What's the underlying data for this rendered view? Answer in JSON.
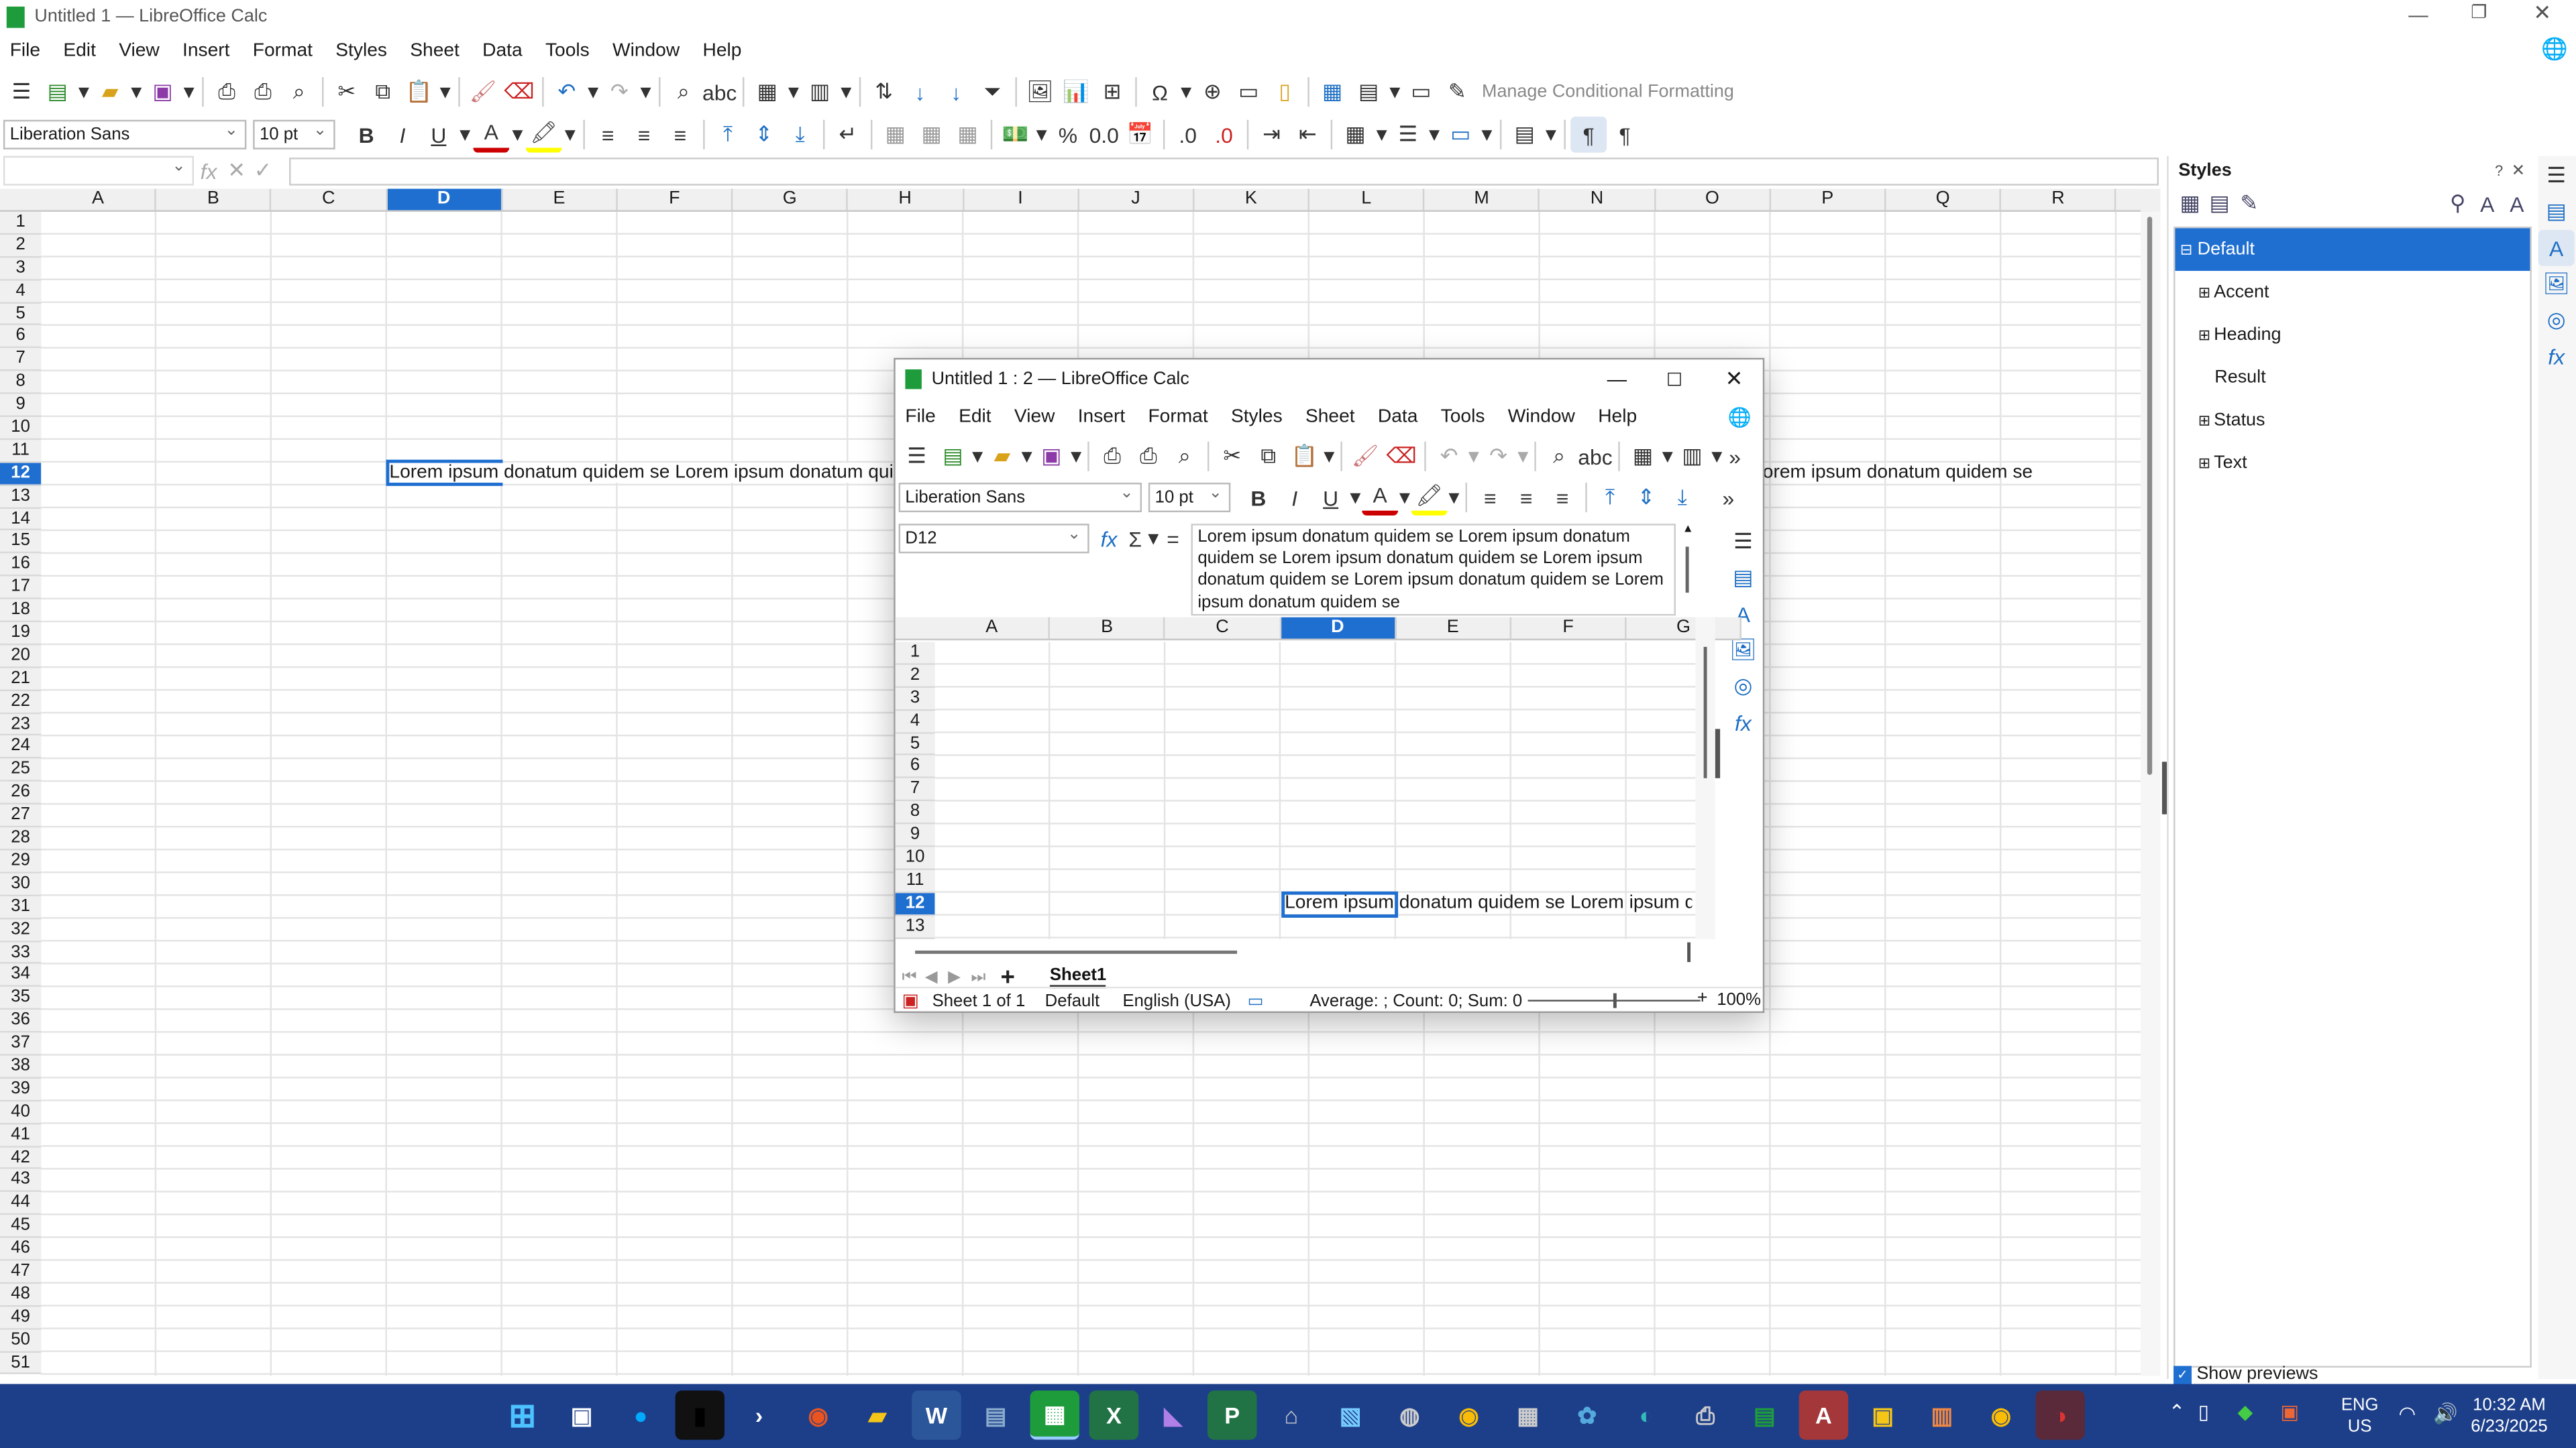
{
  "main": {
    "title": "Untitled 1 — LibreOffice Calc",
    "menu": [
      "File",
      "Edit",
      "View",
      "Insert",
      "Format",
      "Styles",
      "Sheet",
      "Data",
      "Tools",
      "Window",
      "Help"
    ],
    "font_name": "Liberation Sans",
    "font_size": "10 pt",
    "cf_label": "Manage Conditional Formatting",
    "columns": [
      "A",
      "B",
      "C",
      "D",
      "E",
      "F",
      "G",
      "H",
      "I",
      "J",
      "K",
      "L",
      "M",
      "N",
      "O",
      "P",
      "Q",
      "R"
    ],
    "selected_col": "D",
    "selected_row": "12",
    "rows": [
      "1",
      "2",
      "3",
      "4",
      "5",
      "6",
      "7",
      "8",
      "9",
      "10",
      "11",
      "12",
      "13",
      "14",
      "15",
      "16",
      "17",
      "18",
      "19",
      "20",
      "21",
      "22",
      "23",
      "24",
      "25",
      "26",
      "27",
      "28",
      "29",
      "30",
      "31",
      "32",
      "33",
      "34",
      "35",
      "36",
      "37",
      "38",
      "39",
      "40",
      "41",
      "42",
      "43",
      "44",
      "45",
      "46",
      "47",
      "48",
      "49",
      "50",
      "51"
    ],
    "cell_text_left": "Lorem ipsum donatum quidem se Lorem ipsum donatum quidem",
    "cell_text_right": "orem ipsum donatum quidem se"
  },
  "sidebar": {
    "title": "Styles",
    "items": [
      "Default",
      "Accent",
      "Heading",
      "Result",
      "Status",
      "Text"
    ],
    "show_previews": "Show previews"
  },
  "dialog": {
    "title": "Untitled 1 : 2 — LibreOffice Calc",
    "menu": [
      "File",
      "Edit",
      "View",
      "Insert",
      "Format",
      "Styles",
      "Sheet",
      "Data",
      "Tools",
      "Window",
      "Help"
    ],
    "font_name": "Liberation Sans",
    "font_size": "10 pt",
    "name_box": "D12",
    "formula": "Lorem ipsum donatum quidem se Lorem ipsum donatum quidem se Lorem ipsum donatum quidem se Lorem ipsum donatum quidem se Lorem ipsum donatum quidem se Lorem ipsum donatum quidem se",
    "columns": [
      "A",
      "B",
      "C",
      "D",
      "E",
      "F",
      "G"
    ],
    "rows": [
      "1",
      "2",
      "3",
      "4",
      "5",
      "6",
      "7",
      "8",
      "9",
      "10",
      "11",
      "12",
      "13"
    ],
    "cell_text": "Lorem ipsum donatum quidem se Lorem ipsum dor",
    "sheet_tab": "Sheet1",
    "status": {
      "sheet": "Sheet 1 of 1",
      "style": "Default",
      "lang": "English (USA)",
      "sum": "Average: ; Count: 0; Sum: 0",
      "zoom": "100%"
    }
  },
  "taskbar": {
    "lang": "ENG",
    "region": "US",
    "time": "10:32 AM",
    "date": "6/23/2025"
  }
}
